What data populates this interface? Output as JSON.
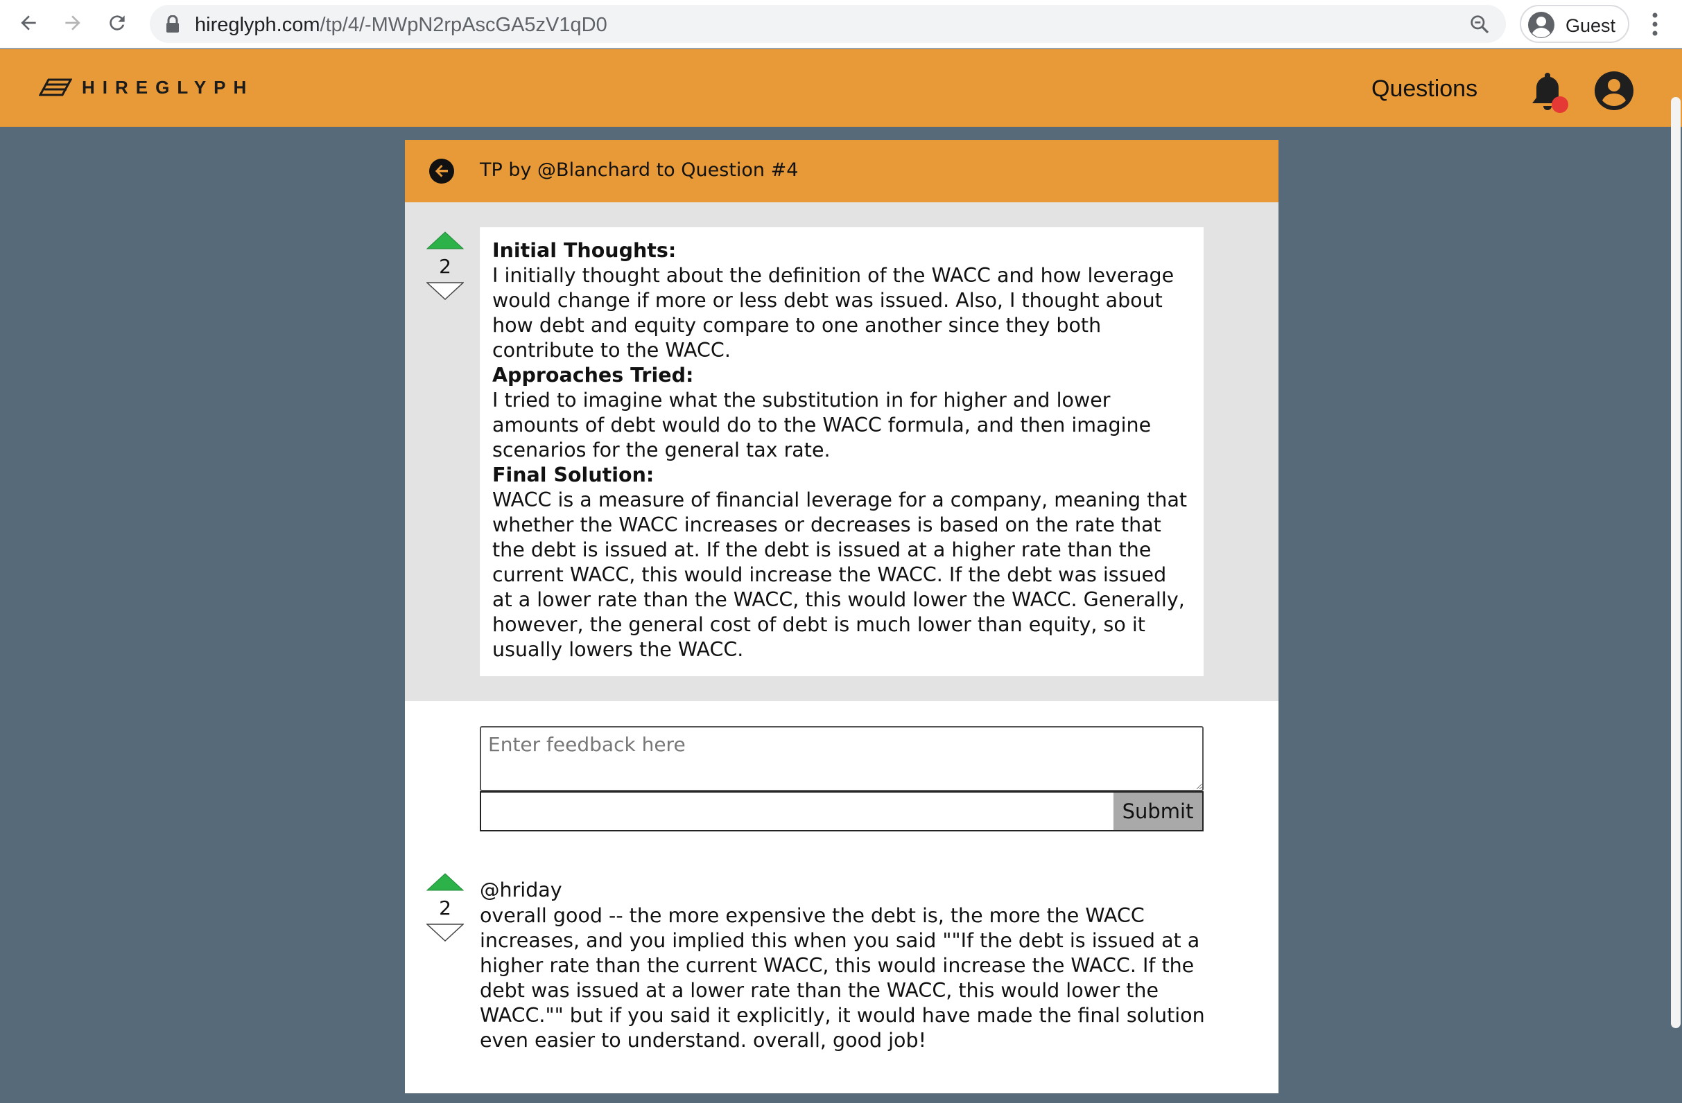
{
  "browser": {
    "url_domain": "hireglyph.com",
    "url_path": "/tp/4/-MWpN2rpAscGA5zV1qD0",
    "profile_label": "Guest"
  },
  "header": {
    "logo_text": "HIREGLYPH",
    "nav_questions": "Questions",
    "notification_indicator": true
  },
  "card": {
    "title": "TP by @Blanchard to Question #4",
    "tp_votes": "2",
    "sections": [
      {
        "heading": "Initial Thoughts:",
        "text": "I initially thought about the definition of the WACC and how leverage would change if more or less debt was issued. Also, I thought about how debt and equity compare to one another since they both contribute to the WACC."
      },
      {
        "heading": "Approaches Tried:",
        "text": "I tried to imagine what the substitution in for higher and lower amounts of debt would do to the WACC formula, and then imagine scenarios for the general tax rate."
      },
      {
        "heading": "Final Solution:",
        "text": "WACC is a measure of financial leverage for a company, meaning that whether the WACC increases or decreases is based on the rate that the debt is issued at. If the debt is issued at a higher rate than the current WACC, this would increase the WACC. If the debt was issued at a lower rate than the WACC, this would lower the WACC. Generally, however, the general cost of debt is much lower than equity, so it usually lowers the WACC."
      }
    ],
    "feedback_placeholder": "Enter feedback here",
    "feedback_value": "",
    "submit_label": "Submit",
    "comments": [
      {
        "user": "@hriday",
        "votes": "2",
        "text": "overall good -- the more expensive the debt is, the more the WACC increases, and you implied this when you said \"\"If the debt is issued at a higher rate than the current WACC, this would increase the WACC. If the debt was issued at a lower rate than the WACC, this would lower the WACC.\"\" but if you said it explicitly, it would have made the final solution even easier to understand. overall, good job!"
      }
    ]
  },
  "colors": {
    "brand_orange": "#e89a38",
    "page_background": "#566a79",
    "upvote_green": "#2db24a",
    "tp_area_gray": "#e3e3e3",
    "notification_red": "#e53935"
  },
  "icons": {
    "back": "arrow-left-circle-icon",
    "forward": "arrow-right-icon",
    "reload": "reload-icon",
    "lock": "lock-icon",
    "zoom": "zoom-icon",
    "profile": "account-circle-icon",
    "menu": "kebab-menu-icon",
    "logo": "hireglyph-logo-icon",
    "bell": "bell-icon",
    "user": "user-avatar-icon",
    "card_back": "back-arrow-circle-icon",
    "upvote": "upvote-triangle-icon",
    "downvote": "downvote-triangle-icon"
  }
}
